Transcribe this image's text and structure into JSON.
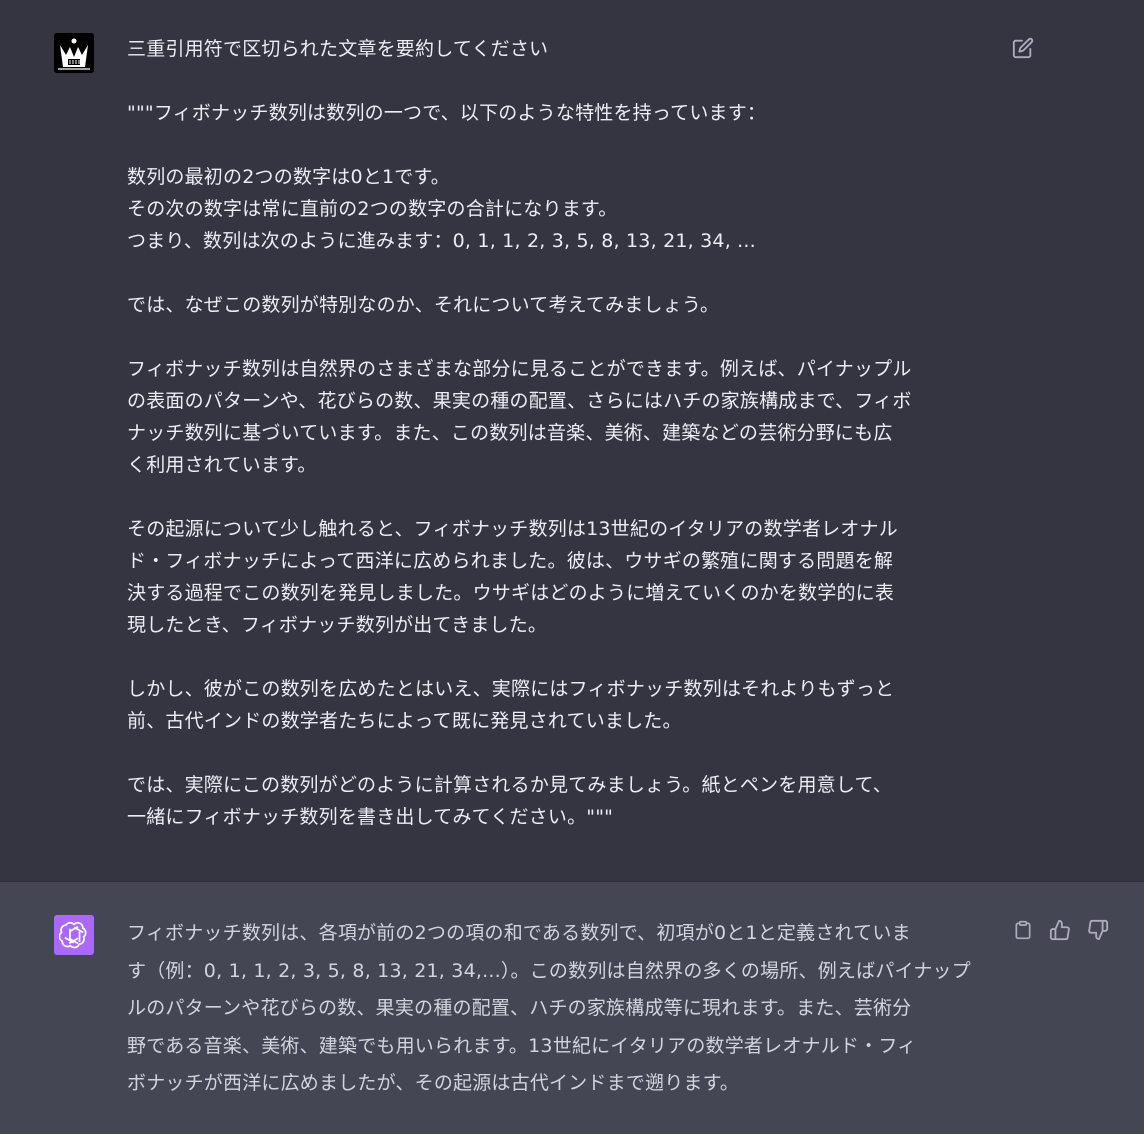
{
  "user_message": {
    "lines": [
      "三重引用符で区切られた文章を要約してください",
      "",
      "\"\"\"フィボナッチ数列は数列の一つで、以下のような特性を持っています：",
      "",
      "数列の最初の2つの数字は0と1です。",
      "その次の数字は常に直前の2つの数字の合計になります。",
      "つまり、数列は次のように進みます：0, 1, 1, 2, 3, 5, 8, 13, 21, 34, ...",
      "",
      "では、なぜこの数列が特別なのか、それについて考えてみましょう。",
      "",
      "フィボナッチ数列は自然界のさまざまな部分に見ることができます。例えば、パイナップル",
      "の表面のパターンや、花びらの数、果実の種の配置、さらにはハチの家族構成まで、フィボ",
      "ナッチ数列に基づいています。また、この数列は音楽、美術、建築などの芸術分野にも広",
      "く利用されています。",
      "",
      "その起源について少し触れると、フィボナッチ数列は13世紀のイタリアの数学者レオナル",
      "ド・フィボナッチによって西洋に広められました。彼は、ウサギの繁殖に関する問題を解",
      "決する過程でこの数列を発見しました。ウサギはどのように増えていくのかを数学的に表",
      "現したとき、フィボナッチ数列が出てきました。",
      "",
      "しかし、彼がこの数列を広めたとはいえ、実際にはフィボナッチ数列はそれよりもずっと",
      "前、古代インドの数学者たちによって既に発見されていました。",
      "",
      "では、実際にこの数列がどのように計算されるか見てみましょう。紙とペンを用意して、",
      "一緒にフィボナッチ数列を書き出してみてください。\"\"\""
    ],
    "edit_icon": "edit-icon",
    "avatar_icon": "crown-user-avatar"
  },
  "assistant_message": {
    "lines": [
      "フィボナッチ数列は、各項が前の2つの項の和である数列で、初項が0と1と定義されていま",
      "す（例：0, 1, 1, 2, 3, 5, 8, 13, 21, 34,...）。この数列は自然界の多くの場所、例えばパイナップ",
      "ルのパターンや花びらの数、果実の種の配置、ハチの家族構成等に現れます。また、芸術分",
      "野である音楽、美術、建築でも用いられます。13世紀にイタリアの数学者レオナルド・フィ",
      "ボナッチが西洋に広めましたが、その起源は古代インドまで遡ります。"
    ],
    "avatar_icon": "openai-logo",
    "avatar_color": "#ab68ff",
    "actions": [
      "clipboard-icon",
      "thumbs-up-icon",
      "thumbs-down-icon"
    ]
  },
  "colors": {
    "user_bg": "#343541",
    "assistant_bg": "#444654",
    "text": "#ececf1",
    "icon": "#acacbe"
  }
}
